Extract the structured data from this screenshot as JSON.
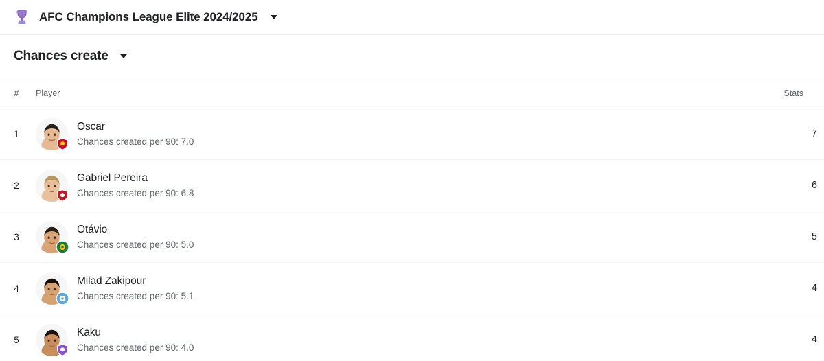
{
  "header": {
    "icon": "trophy-icon",
    "competition": "AFC Champions League Elite 2024/2025",
    "dropdown_icon": "chevron-down-icon"
  },
  "stat_selector": {
    "label": "Chances create",
    "dropdown_icon": "chevron-down-icon"
  },
  "table": {
    "columns": {
      "rank": "#",
      "player": "Player",
      "stats": "Stats"
    },
    "rows": [
      {
        "rank": "1",
        "name": "Oscar",
        "sub": "Chances created per 90: 7.0",
        "stat": "7",
        "badge_color": "#c8102e",
        "badge_accent": "#f5d000",
        "badge_shape": "shield",
        "skin": "#e6b893",
        "hair": "#2b2017"
      },
      {
        "rank": "2",
        "name": "Gabriel Pereira",
        "sub": "Chances created per 90: 6.8",
        "stat": "6",
        "badge_color": "#b81b21",
        "badge_accent": "#ffffff",
        "badge_shape": "shield",
        "skin": "#e9c09b",
        "hair": "#b8975f"
      },
      {
        "rank": "3",
        "name": "Otávio",
        "sub": "Chances created per 90: 5.0",
        "stat": "5",
        "badge_color": "#1b7a3e",
        "badge_accent": "#f2c21a",
        "badge_shape": "circle",
        "skin": "#d9a376",
        "hair": "#2a1d14"
      },
      {
        "rank": "4",
        "name": "Milad Zakipour",
        "sub": "Chances created per 90: 5.1",
        "stat": "4",
        "badge_color": "#5fa8dc",
        "badge_accent": "#ffffff",
        "badge_shape": "circle",
        "skin": "#d7a272",
        "hair": "#16100b"
      },
      {
        "rank": "5",
        "name": "Kaku",
        "sub": "Chances created per 90: 4.0",
        "stat": "4",
        "badge_color": "#8c52c6",
        "badge_accent": "#ffffff",
        "badge_shape": "shield",
        "skin": "#c98d5c",
        "hair": "#1a120c"
      }
    ]
  },
  "colors": {
    "accent": "#8e6fc4",
    "text_primary": "#202124",
    "text_secondary": "#5f6368",
    "divider": "#f1f3f4",
    "background": "#ffffff"
  }
}
